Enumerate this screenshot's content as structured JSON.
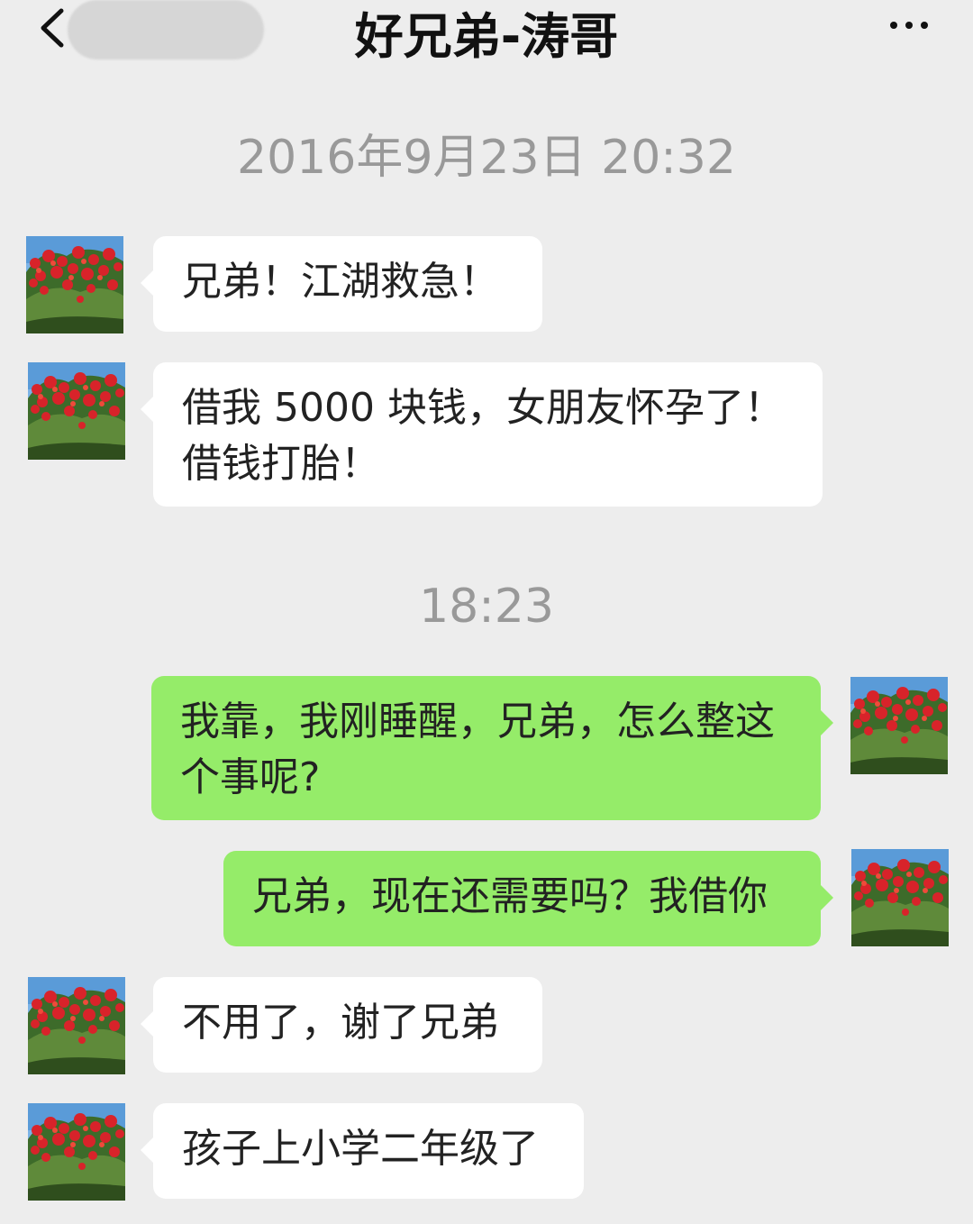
{
  "header": {
    "title": "好兄弟-涛哥"
  },
  "timestamps": {
    "first": "2016年9月23日 20:32",
    "second": "18:23"
  },
  "messages": [
    {
      "side": "in",
      "lines": [
        "兄弟！江湖救急！"
      ]
    },
    {
      "side": "in",
      "lines": [
        "借我 5000 块钱，女朋友怀孕了！",
        "借钱打胎！"
      ]
    },
    {
      "side": "out",
      "lines": [
        "我靠，我刚睡醒，兄弟，怎么整这",
        "个事呢?"
      ]
    },
    {
      "side": "out",
      "lines": [
        "兄弟，现在还需要吗？我借你"
      ]
    },
    {
      "side": "in",
      "lines": [
        "不用了，谢了兄弟"
      ]
    },
    {
      "side": "in",
      "lines": [
        "孩子上小学二年级了"
      ]
    }
  ],
  "colors": {
    "background": "#ededed",
    "incoming_bubble": "#ffffff",
    "outgoing_bubble": "#95ec69"
  },
  "icons": {
    "back": "chevron-left-icon",
    "more": "more-dots-icon",
    "avatar": "flowering-tree-photo"
  }
}
